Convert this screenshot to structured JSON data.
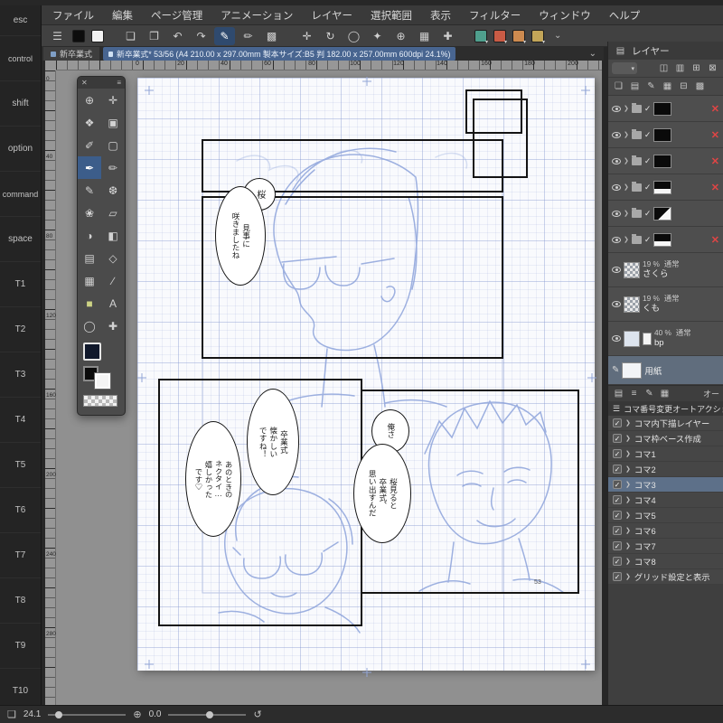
{
  "menu_bar": {
    "items": [
      "ファイル",
      "編集",
      "ページ管理",
      "アニメーション",
      "レイヤー",
      "選択範囲",
      "表示",
      "フィルター",
      "ウィンドウ",
      "ヘルプ"
    ]
  },
  "toolbar": {
    "icons": [
      {
        "name": "main-menu",
        "glyph": "☰"
      },
      {
        "name": "new-canvas",
        "glyph": "❏"
      },
      {
        "name": "duplicate-canvas",
        "glyph": "❐"
      },
      {
        "name": "undo",
        "glyph": "↶"
      },
      {
        "name": "redo",
        "glyph": "↷"
      },
      {
        "name": "pen-pressure",
        "glyph": "✎"
      },
      {
        "name": "marker",
        "glyph": "✏"
      },
      {
        "name": "screen-tone",
        "glyph": "▩"
      },
      {
        "name": "move-view",
        "glyph": "✛"
      },
      {
        "name": "rotate-view",
        "glyph": "↻"
      },
      {
        "name": "lasso-select",
        "glyph": "◯"
      },
      {
        "name": "auto-select",
        "glyph": "✦"
      },
      {
        "name": "zoom-view",
        "glyph": "⊕"
      },
      {
        "name": "grid-toggle",
        "glyph": "▦"
      },
      {
        "name": "add-tool",
        "glyph": "✚"
      }
    ],
    "main_color_style": "background:#0d0d0d",
    "sub_color_style": "background:#f2f2f2",
    "chips": [
      {
        "name": "chip-teal",
        "style": "background:#4f9f8d"
      },
      {
        "name": "chip-red",
        "style": "background:#c95b45"
      },
      {
        "name": "chip-orange",
        "style": "background:#cd8a4f"
      },
      {
        "name": "chip-khaki",
        "style": "background:#c2a558"
      }
    ],
    "collapse_glyph": "⌄"
  },
  "tab_bar": {
    "active_tab": "新卒業式",
    "document_info": "新卒業式* 53/56 (A4 210.00 x 297.00mm 製本サイズ:B5 判 182.00 x 257.00mm 600dpi 24.1%)",
    "collapse_glyph": "⌄"
  },
  "edge_keys": [
    "esc",
    "control",
    "shift",
    "option",
    "command",
    "space",
    "T1",
    "T2",
    "T3",
    "T4",
    "T5",
    "T6",
    "T7",
    "T8",
    "T9",
    "T10"
  ],
  "tool_palette": {
    "close_glyph": "✕",
    "menu_glyph": "≡",
    "tools": [
      {
        "name": "zoom-tool",
        "glyph": "⊕"
      },
      {
        "name": "move-tool",
        "glyph": "✛"
      },
      {
        "name": "hand-tool",
        "glyph": "❖"
      },
      {
        "name": "object-tool",
        "glyph": "▣"
      },
      {
        "name": "eyedropper-tool",
        "glyph": "✐"
      },
      {
        "name": "marquee-tool",
        "glyph": "▢"
      },
      {
        "name": "pen-tool",
        "glyph": "✒",
        "selected": true
      },
      {
        "name": "pencil-tool",
        "glyph": "✏"
      },
      {
        "name": "brush-tool",
        "glyph": "✎"
      },
      {
        "name": "airbrush-tool",
        "glyph": "❆"
      },
      {
        "name": "decoration-tool",
        "glyph": "❀"
      },
      {
        "name": "eraser-tool",
        "glyph": "▱"
      },
      {
        "name": "blend-tool",
        "glyph": "◑"
      },
      {
        "name": "fill-tool",
        "glyph": "◧"
      },
      {
        "name": "gradient-tool",
        "glyph": "▤"
      },
      {
        "name": "figure-tool",
        "glyph": "◇"
      },
      {
        "name": "frame-border-tool",
        "glyph": "▦"
      },
      {
        "name": "ruler-tool",
        "glyph": "∕"
      },
      {
        "name": "selection-layer-tool",
        "glyph": "■"
      },
      {
        "name": "text-tool",
        "glyph": "A"
      },
      {
        "name": "balloon-tool",
        "glyph": "◯"
      },
      {
        "name": "subtool-add",
        "glyph": "✚"
      }
    ]
  },
  "rulers": {
    "top_numbers": [
      "0",
      "20",
      "40",
      "60",
      "80",
      "100",
      "120",
      "140",
      "160",
      "180",
      "200"
    ],
    "left_numbers": [
      "0",
      "40",
      "80",
      "120",
      "160",
      "200",
      "240",
      "280"
    ]
  },
  "page": {
    "bubbles": [
      {
        "name": "bubble-sakura",
        "text": "桜"
      },
      {
        "name": "bubble-migoto",
        "text": "見事に\n咲きましたね"
      },
      {
        "name": "bubble-sotsugyoshiki",
        "text": "卒業式\n懐かしい\nですね！"
      },
      {
        "name": "bubble-anotoki",
        "text": "あのときの\nネクタイ…\n嬉しかった\nです♡"
      },
      {
        "name": "bubble-oresa",
        "text": "俺さ"
      },
      {
        "name": "bubble-sakuramiruto",
        "text": "桜見ると\n卒業式、\n思い出すんだ"
      }
    ],
    "page_number": "53"
  },
  "layers_panel": {
    "title": "レイヤー",
    "layers": [
      {
        "name": "さくら",
        "opacity": "19 %",
        "mode": "通常"
      },
      {
        "name": "くも",
        "opacity": "19 %",
        "mode": "通常"
      },
      {
        "name": "bp",
        "opacity": "40 %",
        "mode": "通常"
      },
      {
        "name": "用紙"
      }
    ]
  },
  "auto_action_panel": {
    "tab_label": "オー",
    "title": "コマ番号変更オートアクション",
    "items": [
      "コマ内下描レイヤー",
      "コマ枠ベース作成",
      "コマ1",
      "コマ2",
      "コマ3",
      "コマ4",
      "コマ5",
      "コマ6",
      "コマ7",
      "コマ8",
      "グリッド設定と表示"
    ],
    "selected_item": "コマ3"
  },
  "status_bar": {
    "zoom": "24.1",
    "rotation": "0.0"
  },
  "colors": {
    "info_bar": "#486590",
    "selection_accent": "#5d7089",
    "draft_mark": "#e04545",
    "sketch_blue": "#8ea4db"
  }
}
